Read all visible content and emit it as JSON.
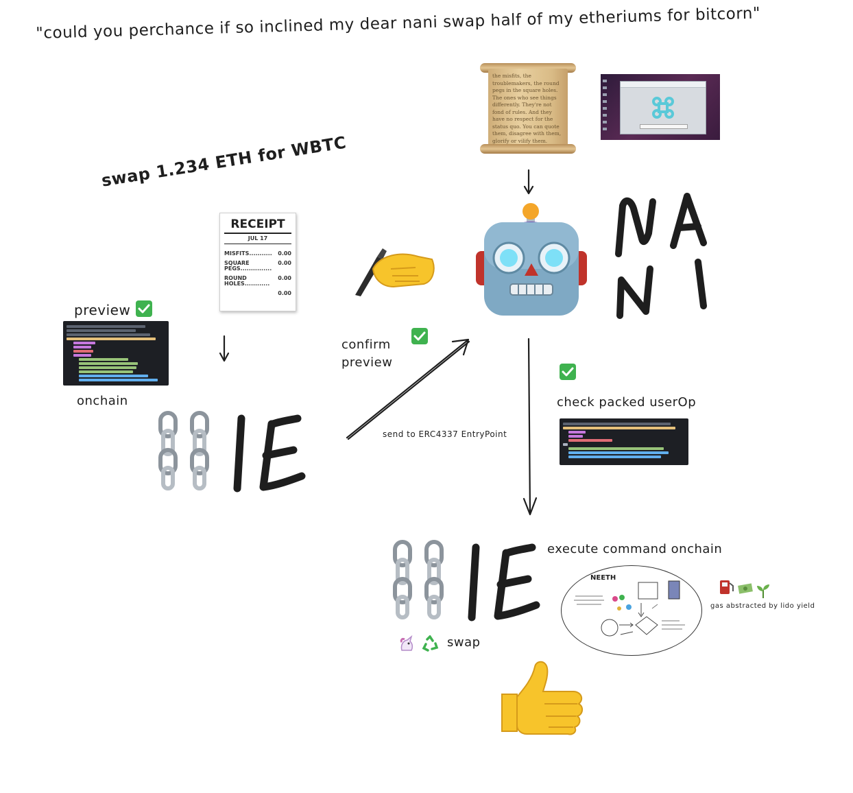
{
  "texts": {
    "quote": "\"could you perchance if so inclined my dear nani swap half of my etheriums for bitcorn\"",
    "swap_title": "swap 1.234 ETH for WBTC",
    "preview": "preview",
    "onchain": "onchain",
    "confirm": "confirm",
    "preview2": "preview",
    "send_to": "send to ERC4337 EntryPoint",
    "check_packed": "check packed userOp",
    "execute": "execute command onchain",
    "swap": "swap",
    "gas": "gas abstracted by lido yield",
    "neeth": "NEETH"
  },
  "receipt": {
    "title": "RECEIPT",
    "date": "JUL 17",
    "rows": [
      {
        "label": "MISFITS...........",
        "value": "0.00"
      },
      {
        "label": "SQUARE PEGS...............",
        "value": "0.00"
      },
      {
        "label": "ROUND HOLES............",
        "value": "0.00"
      },
      {
        "label": "",
        "value": "0.00"
      }
    ]
  },
  "scroll_text": "the misfits, the troublemakers, the round pegs in the square holes. The ones who see things differently. They're not fond of rules. And they have no respect for the status quo. You can quote them, disagree with them, glorify or vilify them. About the only thing you can't do is ignore them. Because they change things.",
  "icons": {
    "check": "check-mark-icon",
    "pen_hand": "writing-hand-icon",
    "robot": "robot-icon",
    "thumbs_up": "thumbs-up-icon",
    "unicorn": "unicorn-icon",
    "recycle": "recycle-icon",
    "fuel": "fuel-pump-icon",
    "money": "money-icon",
    "seedling": "seedling-icon",
    "chain": "chain-icon"
  },
  "colors": {
    "ink": "#1e1e1e",
    "check_green": "#3fb24f",
    "robot_face": "#7fa9c4",
    "robot_eye": "#7ee0f7",
    "robot_antenna": "#f4a62a",
    "robot_ear": "#c0332b",
    "thumb": "#f7c42b"
  }
}
